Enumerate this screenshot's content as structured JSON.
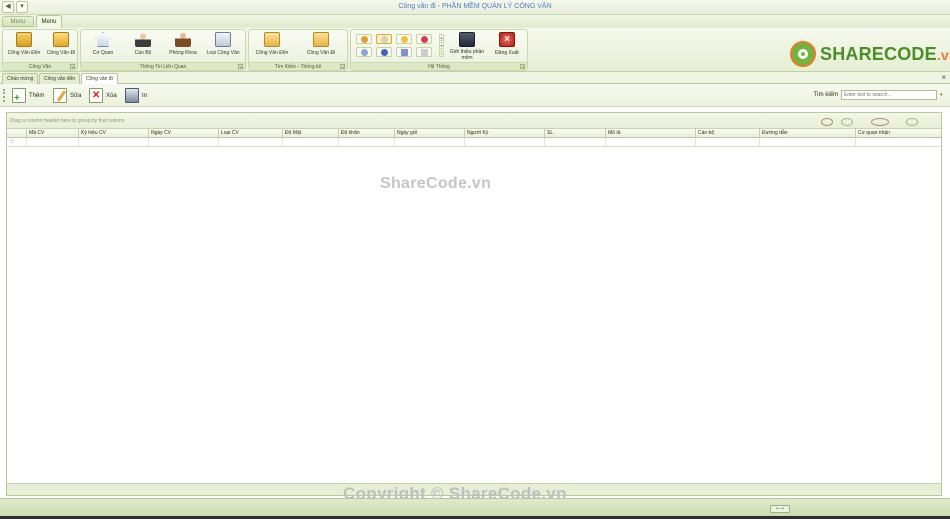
{
  "window": {
    "title": "Công văn đi - PHẦN MỀM QUẢN LÝ CÔNG VĂN"
  },
  "quick_access": [
    "◀",
    "▾"
  ],
  "ribbon": {
    "app_menu_label": "Menu",
    "tab_menu": "Menu",
    "groups": {
      "cong_van": {
        "caption": "Công Văn",
        "buttons": [
          "Công Văn Đến",
          "Công Văn Đi"
        ]
      },
      "thong_tin": {
        "caption": "Thông Tin Liên Quan",
        "buttons": [
          "Cơ Quan",
          "Cán Bộ",
          "Phòng Khoa",
          "Loại Công Văn"
        ]
      },
      "tim_kiem": {
        "caption": "Tìm Kiếm - Thống kê",
        "buttons": [
          "Công Văn Đến",
          "Công Văn Đi"
        ]
      },
      "he_thong": {
        "caption": "Hệ Thống",
        "buttons": [
          "Giới thiệu phần mềm",
          "Đăng Xuất"
        ]
      }
    },
    "launcher_glyph": "↘"
  },
  "logo": {
    "brand": "SHARECODE",
    "tld": ".vn",
    "colors": {
      "green": "#4c8d27",
      "orange": "#e97b2a"
    }
  },
  "doc_tabs": [
    "Chào mừng",
    "Công văn đến",
    "Công văn đi"
  ],
  "doc_close": "×",
  "toolbar": {
    "add": "Thêm",
    "edit": "Sửa",
    "delete": "Xóa",
    "print": "In",
    "search_label": "Tìm kiếm",
    "search_placeholder": "Enter text to search...",
    "search_drop": "▾"
  },
  "grid": {
    "group_hint": "Drag a column header here to group by that column",
    "filter_glyph": "▽",
    "columns": [
      "Mã CV",
      "Ký hiệu CV",
      "Ngày CV",
      "Loại CV",
      "Độ Mật",
      "Độ khẩn",
      "Ngày gửi",
      "Người Ký",
      "SL",
      "Mô tả",
      "Cán bộ",
      "Đường dẫn",
      "Cơ quan nhận"
    ]
  },
  "watermarks": {
    "middle": "ShareCode.vn",
    "bottom": "Copyright © ShareCode.vn"
  },
  "statusbar": {
    "grip_glyph": "⇐⇒"
  }
}
